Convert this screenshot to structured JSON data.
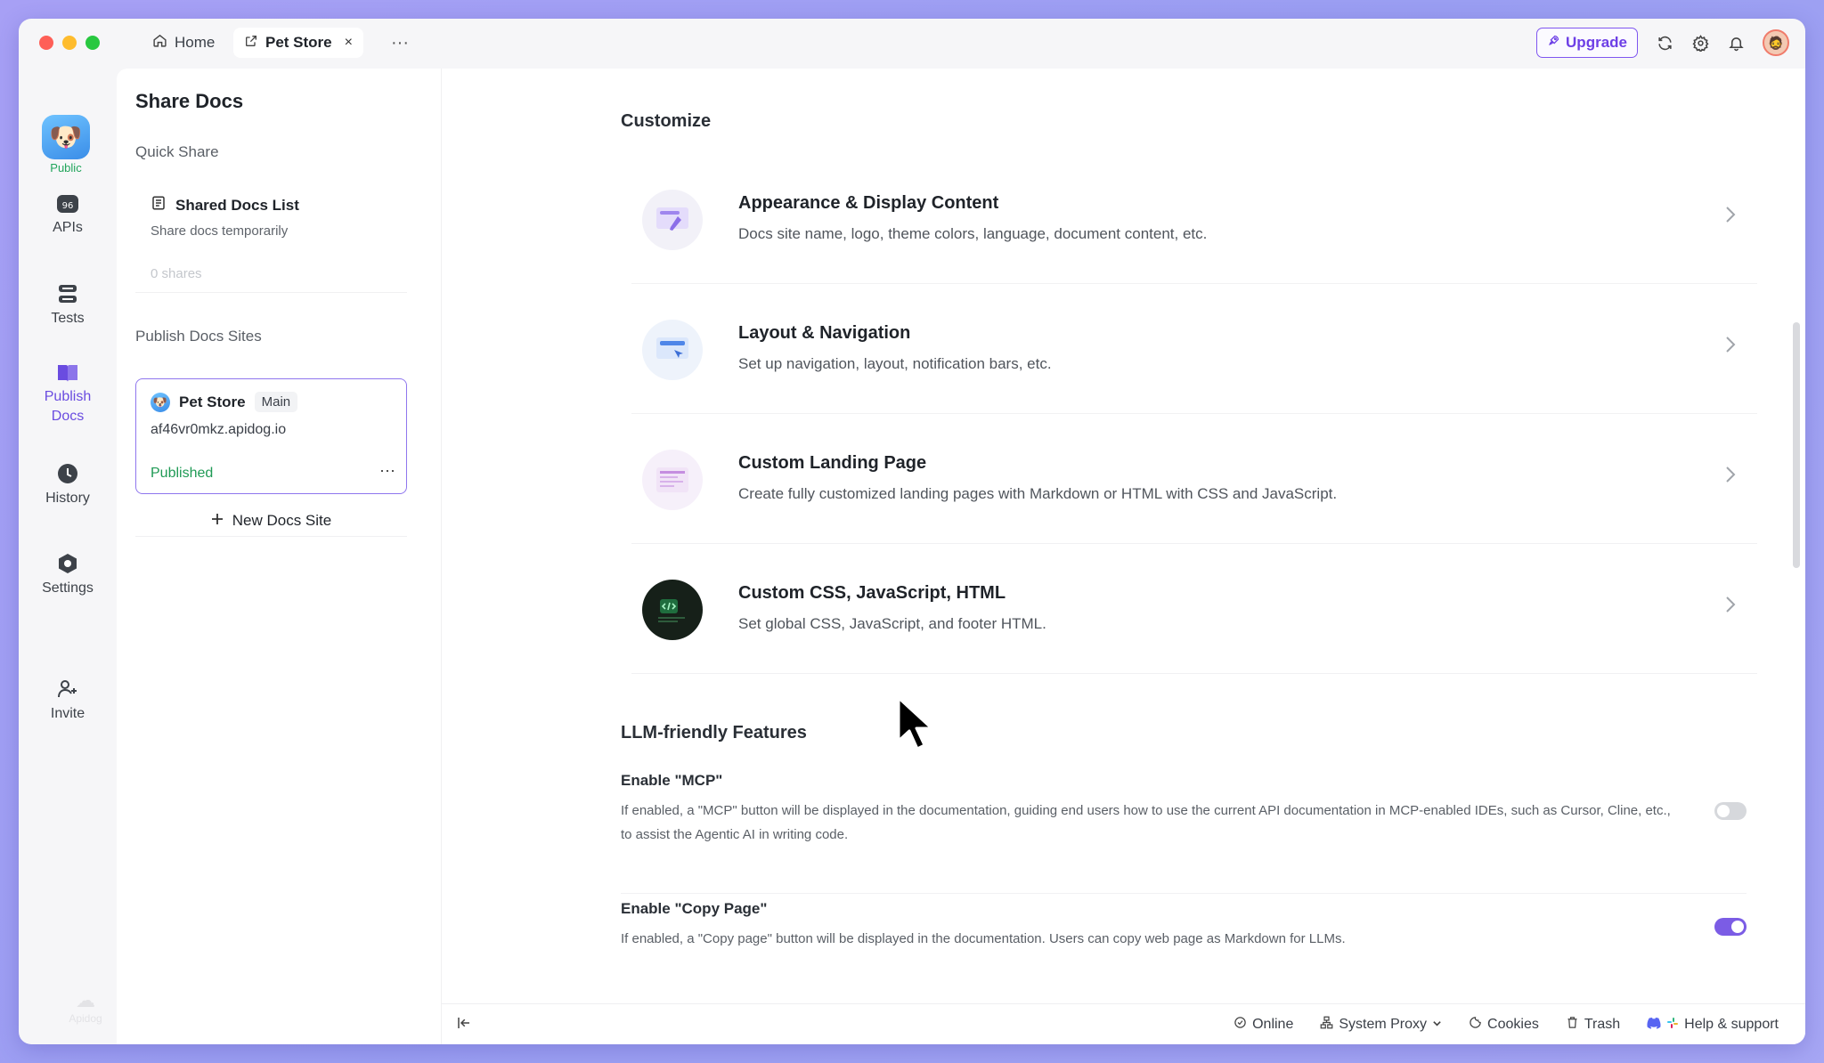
{
  "tabs": {
    "home": "Home",
    "pet_store": "Pet Store",
    "close": "×",
    "more": "···"
  },
  "topbar": {
    "upgrade": "Upgrade"
  },
  "rail": {
    "public_badge": "Public",
    "items": [
      "APIs",
      "Tests",
      "Publish Docs",
      "History",
      "Settings",
      "Invite"
    ],
    "publish_line1": "Publish",
    "publish_line2": "Docs",
    "brand": "Apidog"
  },
  "share": {
    "title": "Share Docs",
    "quick_share": "Quick Share",
    "shared_list_title": "Shared Docs List",
    "shared_list_desc": "Share docs temporarily",
    "shared_count": "0 shares",
    "publish_sites": "Publish Docs Sites",
    "site": {
      "name": "Pet Store",
      "branch": "Main",
      "url": "af46vr0mkz.apidog.io",
      "status": "Published",
      "menu": "···"
    },
    "new_site": "New Docs Site"
  },
  "customize": {
    "heading": "Customize",
    "options": [
      {
        "title": "Appearance & Display Content",
        "desc": "Docs site name, logo, theme colors, language, document content, etc."
      },
      {
        "title": "Layout & Navigation",
        "desc": "Set up navigation, layout, notification bars, etc."
      },
      {
        "title": "Custom Landing Page",
        "desc": "Create fully customized landing pages with Markdown or HTML with CSS and JavaScript."
      },
      {
        "title": "Custom CSS, JavaScript, HTML",
        "desc": "Set global CSS, JavaScript, and footer HTML."
      }
    ]
  },
  "llm": {
    "heading": "LLM-friendly Features",
    "mcp_title": "Enable \"MCP\"",
    "mcp_desc": "If enabled, a \"MCP\" button will be displayed in the documentation, guiding end users how to use the current API documentation in MCP-enabled IDEs, such as Cursor, Cline, etc., to assist the Agentic AI in writing code.",
    "mcp_enabled": false,
    "copy_title": "Enable \"Copy Page\"",
    "copy_desc": "If enabled, a \"Copy page\" button will be displayed in the documentation. Users can copy web page as Markdown for LLMs.",
    "copy_enabled": true
  },
  "statusbar": {
    "online": "Online",
    "proxy": "System Proxy",
    "cookies": "Cookies",
    "trash": "Trash",
    "help": "Help & support"
  },
  "colors": {
    "accent": "#7b5ce5",
    "published": "#1f9a55",
    "public": "#22a55b"
  }
}
